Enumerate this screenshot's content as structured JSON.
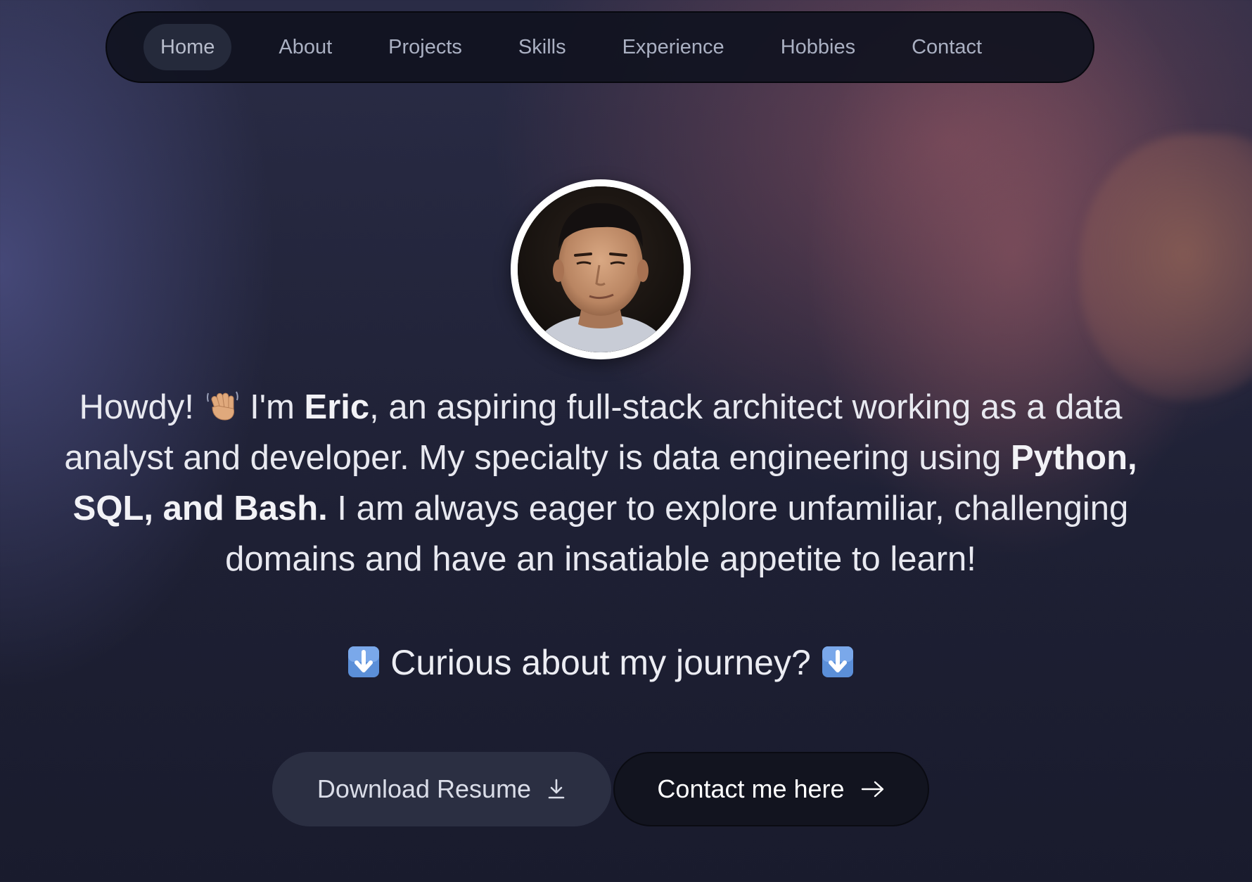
{
  "nav": {
    "items": [
      {
        "label": "Home",
        "active": true
      },
      {
        "label": "About",
        "active": false
      },
      {
        "label": "Projects",
        "active": false
      },
      {
        "label": "Skills",
        "active": false
      },
      {
        "label": "Experience",
        "active": false
      },
      {
        "label": "Hobbies",
        "active": false
      },
      {
        "label": "Contact",
        "active": false
      }
    ]
  },
  "hero": {
    "intro": {
      "part1": "Howdy! ",
      "wave_icon": "waving-hand-icon",
      "part2": " I'm ",
      "name": "Eric",
      "part3": ", an aspiring full-stack architect working as a data analyst and developer. My specialty is data engineering using ",
      "skills": "Python, SQL, and Bash.",
      "part4": " I am always eager to explore unfamiliar, challenging domains and have an insatiable appetite to learn!"
    },
    "journey": {
      "left_icon": "down-arrow-icon",
      "text": "Curious about my journey?",
      "right_icon": "down-arrow-icon"
    }
  },
  "buttons": {
    "resume_label": "Download Resume",
    "resume_icon": "download-icon",
    "contact_label": "Contact me here",
    "contact_icon": "arrow-right-icon"
  },
  "colors": {
    "background": "#1e2034",
    "nav_bg": "#101220",
    "active_pill": "#252a3b",
    "resume_button": "#2b2f42",
    "contact_button": "#12141f",
    "emoji_blue": "#5b8fd8"
  }
}
